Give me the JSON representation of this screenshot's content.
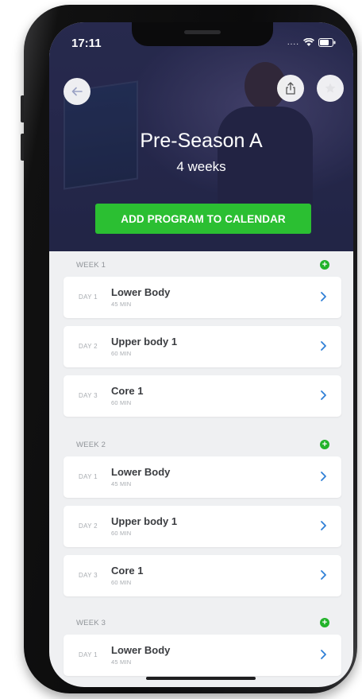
{
  "status_bar": {
    "time": "17:11"
  },
  "header": {
    "title": "Pre-Season A",
    "subtitle": "4 weeks",
    "cta_label": "ADD PROGRAM TO CALENDAR",
    "back_icon": "arrow-left-icon",
    "share_icon": "share-icon",
    "favorite_icon": "star-icon"
  },
  "colors": {
    "accent_green": "#2bbf32",
    "link_blue": "#2f7fd6"
  },
  "weeks": [
    {
      "label": "WEEK 1",
      "days": [
        {
          "day": "DAY 1",
          "title": "Lower Body",
          "duration": "45 MIN"
        },
        {
          "day": "DAY 2",
          "title": "Upper body 1",
          "duration": "60 MIN"
        },
        {
          "day": "DAY 3",
          "title": "Core 1",
          "duration": "60 MIN"
        }
      ]
    },
    {
      "label": "WEEK 2",
      "days": [
        {
          "day": "DAY 1",
          "title": "Lower Body",
          "duration": "45 MIN"
        },
        {
          "day": "DAY 2",
          "title": "Upper body 1",
          "duration": "60 MIN"
        },
        {
          "day": "DAY 3",
          "title": "Core 1",
          "duration": "60 MIN"
        }
      ]
    },
    {
      "label": "WEEK 3",
      "days": [
        {
          "day": "DAY 1",
          "title": "Lower Body",
          "duration": "45 MIN"
        }
      ]
    }
  ]
}
